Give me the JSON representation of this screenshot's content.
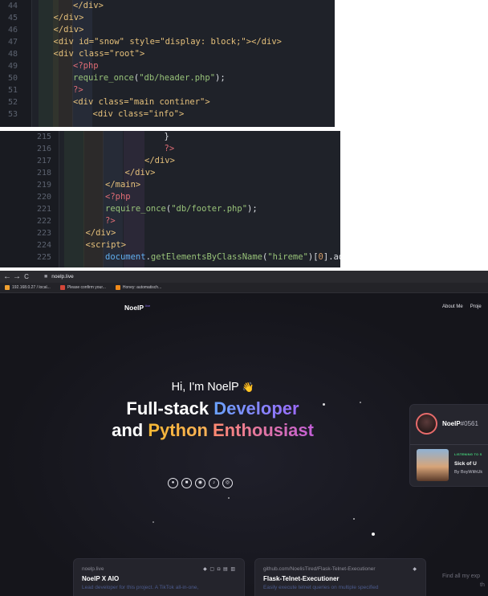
{
  "editor_top": {
    "lines": [
      {
        "n": "44",
        "indent": 2,
        "tokens": [
          {
            "c": "c-tag",
            "t": "</div>"
          }
        ]
      },
      {
        "n": "45",
        "indent": 1,
        "tokens": [
          {
            "c": "c-tag",
            "t": "</div>"
          }
        ]
      },
      {
        "n": "46",
        "indent": 1,
        "tokens": [
          {
            "c": "c-tag",
            "t": "</div>"
          }
        ]
      },
      {
        "n": "47",
        "indent": 1,
        "tokens": [
          {
            "c": "c-tag",
            "t": "<div "
          },
          {
            "c": "c-attr",
            "t": "id="
          },
          {
            "c": "c-str",
            "t": "\"snow\" "
          },
          {
            "c": "c-attr",
            "t": "style="
          },
          {
            "c": "c-str",
            "t": "\"display: block;\""
          },
          {
            "c": "c-tag",
            "t": "></div>"
          }
        ]
      },
      {
        "n": "48",
        "indent": 1,
        "tokens": [
          {
            "c": "c-tag",
            "t": "<div "
          },
          {
            "c": "c-attr",
            "t": "class="
          },
          {
            "c": "c-str",
            "t": "\"root\""
          },
          {
            "c": "c-tag",
            "t": ">"
          }
        ]
      },
      {
        "n": "49",
        "indent": 2,
        "tokens": [
          {
            "c": "c-php",
            "t": "<?php"
          }
        ]
      },
      {
        "n": "50",
        "indent": 2,
        "tokens": [
          {
            "c": "c-fn",
            "t": "require_once"
          },
          {
            "c": "c-plain",
            "t": "("
          },
          {
            "c": "c-fn",
            "t": "\"db/header.php\""
          },
          {
            "c": "c-plain",
            "t": ");"
          }
        ]
      },
      {
        "n": "51",
        "indent": 2,
        "tokens": [
          {
            "c": "c-php",
            "t": "?>"
          }
        ]
      },
      {
        "n": "52",
        "indent": 2,
        "tokens": [
          {
            "c": "c-tag",
            "t": "<div "
          },
          {
            "c": "c-attr",
            "t": "class="
          },
          {
            "c": "c-str",
            "t": "\"main continer\""
          },
          {
            "c": "c-tag",
            "t": ">"
          }
        ]
      },
      {
        "n": "53",
        "indent": 3,
        "tokens": [
          {
            "c": "c-tag",
            "t": "<div "
          },
          {
            "c": "c-attr",
            "t": "class="
          },
          {
            "c": "c-str",
            "t": "\"info\""
          },
          {
            "c": "c-tag",
            "t": ">"
          }
        ]
      }
    ]
  },
  "editor_bottom": {
    "lines": [
      {
        "n": "215",
        "indent": 5,
        "tokens": [
          {
            "c": "c-plain",
            "t": "}"
          }
        ]
      },
      {
        "n": "216",
        "indent": 5,
        "tokens": [
          {
            "c": "c-php",
            "t": "?>"
          }
        ]
      },
      {
        "n": "217",
        "indent": 4,
        "tokens": [
          {
            "c": "c-tag",
            "t": "</div>"
          }
        ]
      },
      {
        "n": "218",
        "indent": 3,
        "tokens": [
          {
            "c": "c-tag",
            "t": "</div>"
          }
        ]
      },
      {
        "n": "219",
        "indent": 2,
        "tokens": [
          {
            "c": "c-tag",
            "t": "</main>"
          }
        ]
      },
      {
        "n": "220",
        "indent": 2,
        "tokens": [
          {
            "c": "c-php",
            "t": "<?php"
          }
        ]
      },
      {
        "n": "221",
        "indent": 2,
        "tokens": [
          {
            "c": "c-fn",
            "t": "require_once"
          },
          {
            "c": "c-plain",
            "t": "("
          },
          {
            "c": "c-fn",
            "t": "\"db/footer.php\""
          },
          {
            "c": "c-plain",
            "t": ");"
          }
        ]
      },
      {
        "n": "222",
        "indent": 2,
        "tokens": [
          {
            "c": "c-php",
            "t": "?>"
          }
        ]
      },
      {
        "n": "223",
        "indent": 1,
        "tokens": [
          {
            "c": "c-tag",
            "t": "</div>"
          }
        ]
      },
      {
        "n": "224",
        "indent": 1,
        "tokens": [
          {
            "c": "c-tag",
            "t": "<script>"
          }
        ]
      },
      {
        "n": "225",
        "indent": 2,
        "tokens": [
          {
            "c": "c-obj",
            "t": "document"
          },
          {
            "c": "c-plain",
            "t": "."
          },
          {
            "c": "c-fn",
            "t": "getElementsByClassName"
          },
          {
            "c": "c-plain",
            "t": "("
          },
          {
            "c": "c-fn",
            "t": "\"hireme\""
          },
          {
            "c": "c-plain",
            "t": ")["
          },
          {
            "c": "c-num",
            "t": "0"
          },
          {
            "c": "c-plain",
            "t": "].add"
          }
        ]
      }
    ]
  },
  "browser": {
    "back": "←",
    "forward": "→",
    "reload": "C",
    "url": "noelp.live",
    "bookmarks": [
      {
        "label": "192.168.0.27 / local...",
        "color": "#f0a030"
      },
      {
        "label": "Please confirm your...",
        "color": "#d44638"
      },
      {
        "label": "Honey: automatisch...",
        "color": "#f08a1a"
      }
    ]
  },
  "site": {
    "logo": "NoelP",
    "logo_sup": ".live",
    "nav": [
      "About Me",
      "Proje"
    ],
    "hi": "Hi, I'm NoelP",
    "wave": "👋",
    "headline1": {
      "a": "Full-stack ",
      "b": "Developer"
    },
    "headline2": {
      "a": "and ",
      "b": "Python ",
      "c": "Enthousiast"
    },
    "socials": [
      {
        "icon": "github-icon",
        "glyph": "●"
      },
      {
        "icon": "discord-icon",
        "glyph": "■"
      },
      {
        "icon": "spotify-icon",
        "glyph": "◉"
      },
      {
        "icon": "tiktok-icon",
        "glyph": "♪"
      },
      {
        "icon": "instagram-icon",
        "glyph": "◎"
      }
    ],
    "discord": {
      "name": "NoelP",
      "tag": "#0561",
      "listening": "LISTENING TO S",
      "song": "Sick of U",
      "artist": "By BoyWithUk"
    },
    "projects": [
      {
        "url": "noelp.live",
        "title": "NoelP X AIO",
        "desc": "Lead developer for this project. A TikTok all-in-one,",
        "icons": "◆ ▢ ◘ ▤ ▥"
      },
      {
        "url": "github.com/NoelisTired/Flask-Telnet-Executioner",
        "title": "Flask-Telnet-Executioner",
        "desc": "Easily execute telnet queries on multiple specified",
        "icons": "◆"
      }
    ],
    "find_more": "Find all my exp",
    "find_more2": "th"
  }
}
